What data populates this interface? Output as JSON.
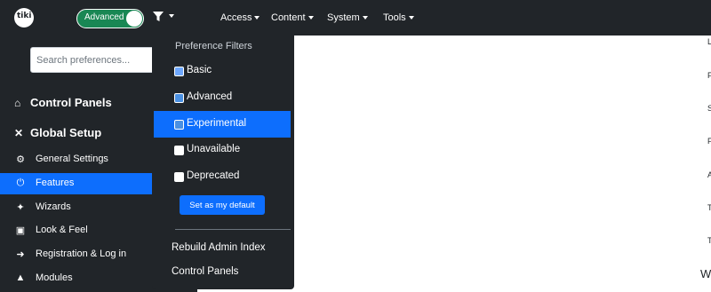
{
  "topbar": {
    "logo_text": "tiki",
    "mode_toggle_label": "Advanced",
    "menus": [
      "Access",
      "Content",
      "System",
      "Tools"
    ]
  },
  "sidebar": {
    "search_placeholder": "Search preferences...",
    "sections": [
      {
        "icon": "home-icon",
        "label": "Control Panels"
      },
      {
        "icon": "tools-icon",
        "label": "Global Setup"
      }
    ],
    "items": [
      {
        "icon": "gear-icon",
        "label": "General Settings",
        "active": false
      },
      {
        "icon": "power-icon",
        "label": "Features",
        "active": true
      },
      {
        "icon": "wand-icon",
        "label": "Wizards",
        "active": false
      },
      {
        "icon": "image-icon",
        "label": "Look & Feel",
        "active": false
      },
      {
        "icon": "sign-in-icon",
        "label": "Registration & Log in",
        "active": false
      },
      {
        "icon": "cubes-icon",
        "label": "Modules",
        "active": false
      }
    ]
  },
  "dropdown": {
    "title": "Preference Filters",
    "options": [
      {
        "label": "Basic",
        "checked": true,
        "active": false
      },
      {
        "label": "Advanced",
        "checked": true,
        "active": false
      },
      {
        "label": "Experimental",
        "checked": true,
        "active": true
      },
      {
        "label": "Unavailable",
        "checked": false,
        "active": false
      },
      {
        "label": "Deprecated",
        "checked": false,
        "active": false
      }
    ],
    "set_default_label": "Set as my default",
    "links": [
      "Rebuild Admin Index",
      "Control Panels"
    ]
  },
  "right_edge": {
    "letters": [
      "L",
      "F",
      "S",
      "F",
      "A",
      "T",
      "T"
    ],
    "last": "W"
  },
  "colors": {
    "dark": "#212529",
    "primary": "#0d6efd",
    "success": "#198754"
  }
}
